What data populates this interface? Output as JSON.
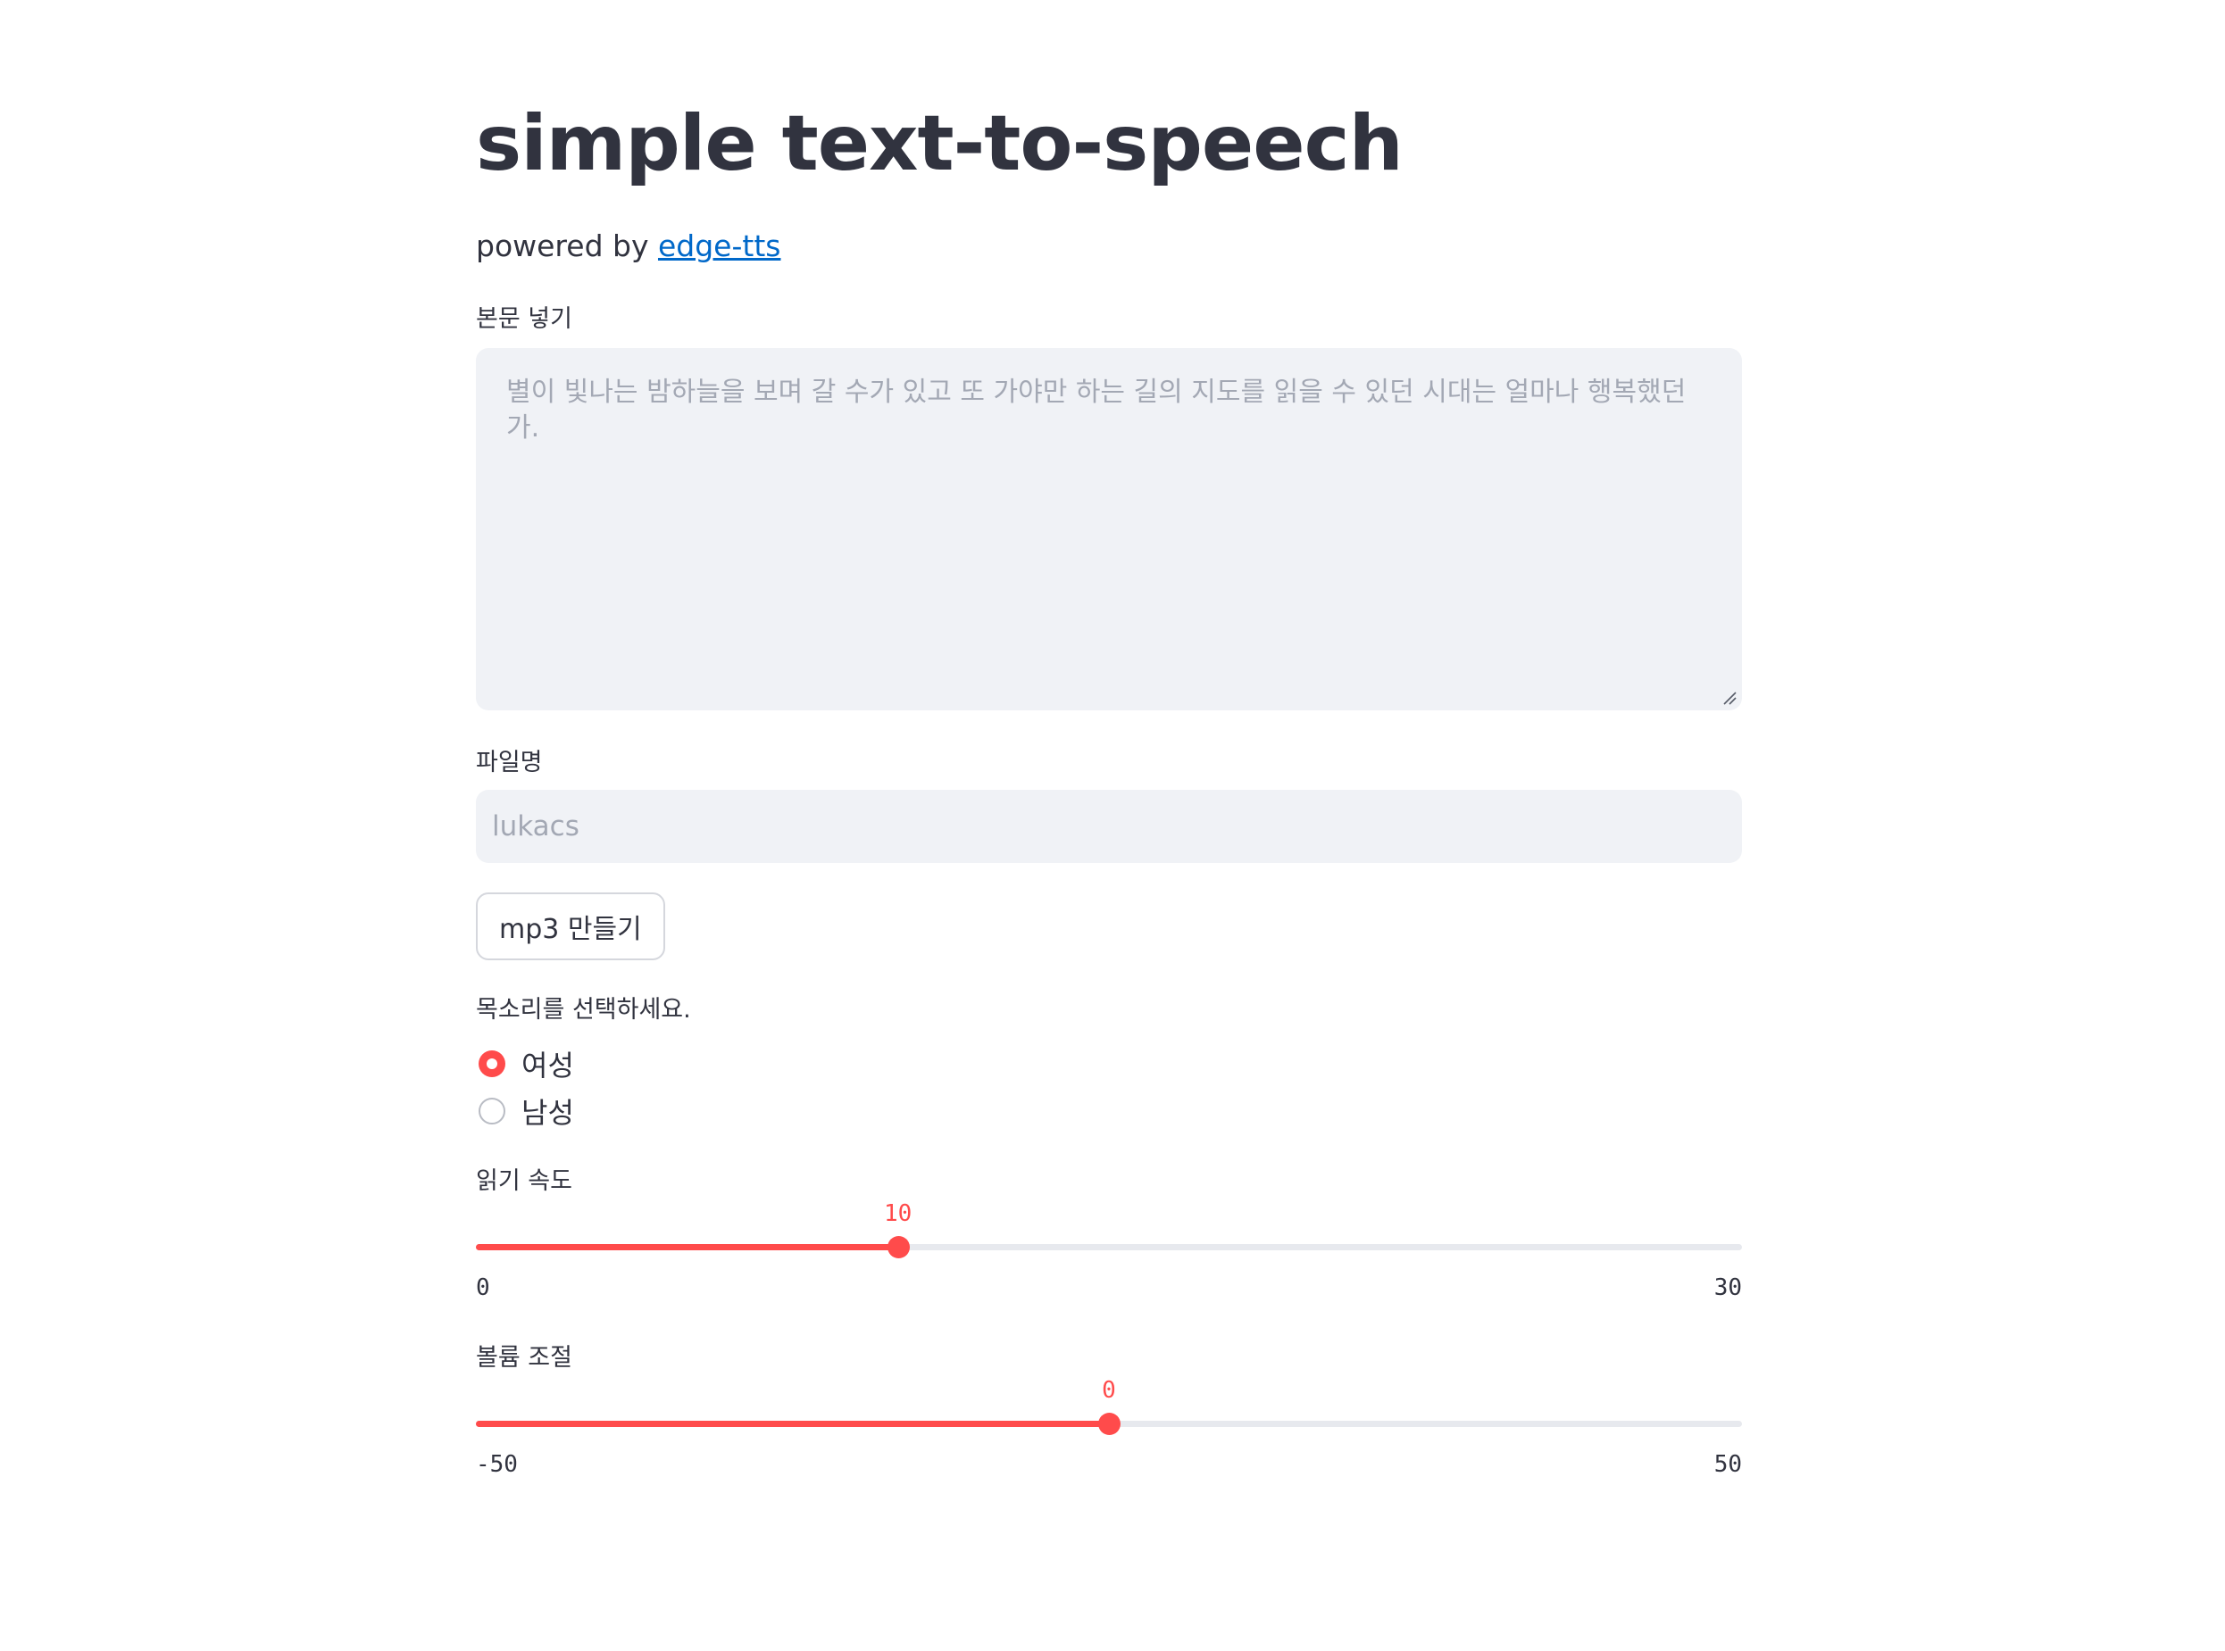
{
  "header": {
    "title": "simple text-to-speech",
    "subtitle_prefix": "powered by ",
    "subtitle_link": "edge-tts"
  },
  "body_text": {
    "label": "본문 넣기",
    "value": "",
    "placeholder": "별이 빛나는 밤하늘을 보며 갈 수가 있고 또 가야만 하는 길의 지도를 읽을 수 있던 시대는 얼마나 행복했던가."
  },
  "filename": {
    "label": "파일명",
    "value": "",
    "placeholder": "lukacs"
  },
  "make_button": {
    "label": "mp3 만들기"
  },
  "voice": {
    "label": "목소리를 선택하세요.",
    "options": [
      {
        "label": "여성",
        "selected": true
      },
      {
        "label": "남성",
        "selected": false
      }
    ]
  },
  "speed": {
    "label": "읽기 속도",
    "min": 0,
    "max": 30,
    "value": 10,
    "min_label": "0",
    "max_label": "30",
    "value_label": "10"
  },
  "volume": {
    "label": "볼륨 조절",
    "min": -50,
    "max": 50,
    "value": 0,
    "min_label": "-50",
    "max_label": "50",
    "value_label": "0"
  },
  "colors": {
    "accent": "#ff4b4b",
    "link": "#0068c9",
    "text": "#31333f",
    "input_bg": "#f0f2f6",
    "track": "#e7e9ee"
  }
}
